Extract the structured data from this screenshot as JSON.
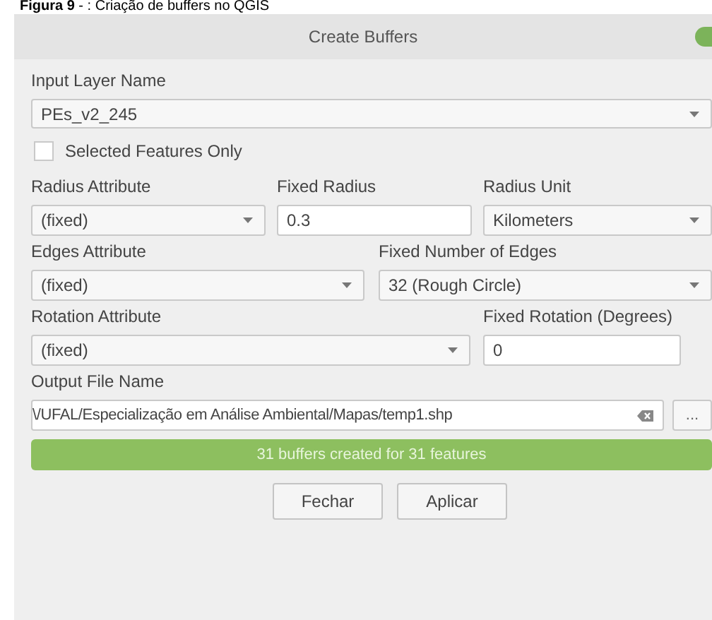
{
  "caption": {
    "label": "Figura 9",
    "text": " - : Criação de buffers no QGIS"
  },
  "window": {
    "title": "Create Buffers"
  },
  "input_layer": {
    "label": "Input Layer Name",
    "value": "PEs_v2_245"
  },
  "selected_only": {
    "label": "Selected Features Only",
    "checked": false
  },
  "rows": [
    [
      {
        "kind": "combo",
        "label": "Radius Attribute",
        "value": "(fixed)"
      },
      {
        "kind": "input",
        "label": "Fixed Radius",
        "value": "0.3"
      },
      {
        "kind": "combo",
        "label": "Radius Unit",
        "value": "Kilometers"
      }
    ],
    [
      {
        "kind": "combo",
        "label": "Edges Attribute",
        "value": "(fixed)"
      },
      {
        "kind": "combo",
        "label": "Fixed Number of Edges",
        "value": "32 (Rough Circle)"
      }
    ],
    [
      {
        "kind": "combo",
        "label": "Rotation Attribute",
        "value": "(fixed)"
      },
      {
        "kind": "input",
        "label": "Fixed Rotation (Degrees)",
        "value": "0"
      }
    ]
  ],
  "output": {
    "label": "Output File Name",
    "value": "\\/UFAL/Especialização em Análise Ambiental/Mapas/temp1.shp",
    "browse": "..."
  },
  "status": {
    "text": "31 buffers created for 31 features"
  },
  "buttons": [
    "Fechar",
    "Aplicar"
  ]
}
